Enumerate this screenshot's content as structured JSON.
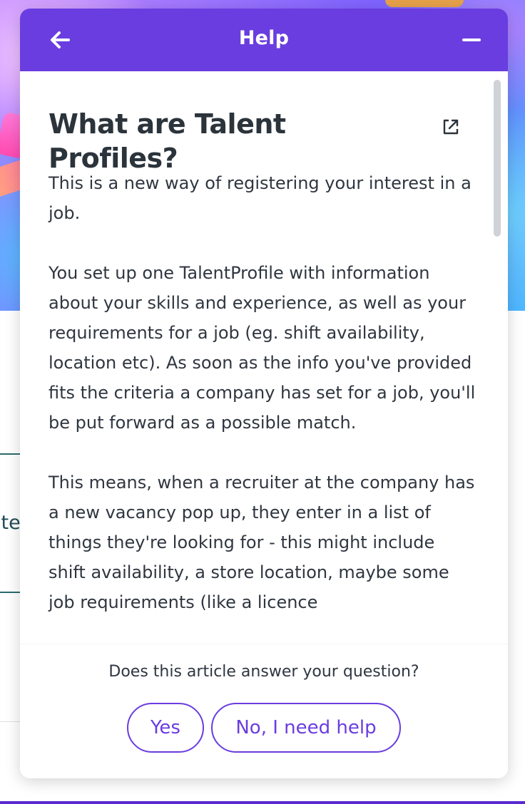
{
  "background": {
    "side_text": "ite"
  },
  "header": {
    "title": "Help",
    "back_icon": "arrow-left-icon",
    "minimize_icon": "minus-icon",
    "color": "#6a3de0"
  },
  "article": {
    "title": "What are Talent Profiles?",
    "external_icon": "external-link-icon",
    "paragraphs": [
      "This is a new way of registering your interest in a job.",
      "You set up one TalentProfile with information about your skills and experience, as well as your requirements for a job (eg. shift availability, location etc). As soon as the info you've provided fits the criteria a company has set for a job, you'll be put forward as a possible match.",
      "This means, when a recruiter at the company has a new vacancy pop up, they enter in a list of things they're looking for - this might include shift availability, a store location, maybe some job requirements (like a licence"
    ]
  },
  "feedback": {
    "question": "Does this article answer your question?",
    "yes_label": "Yes",
    "no_label": "No, I need help"
  },
  "colors": {
    "accent": "#6a3de0",
    "text": "#2f3640",
    "title": "#2b333b"
  }
}
